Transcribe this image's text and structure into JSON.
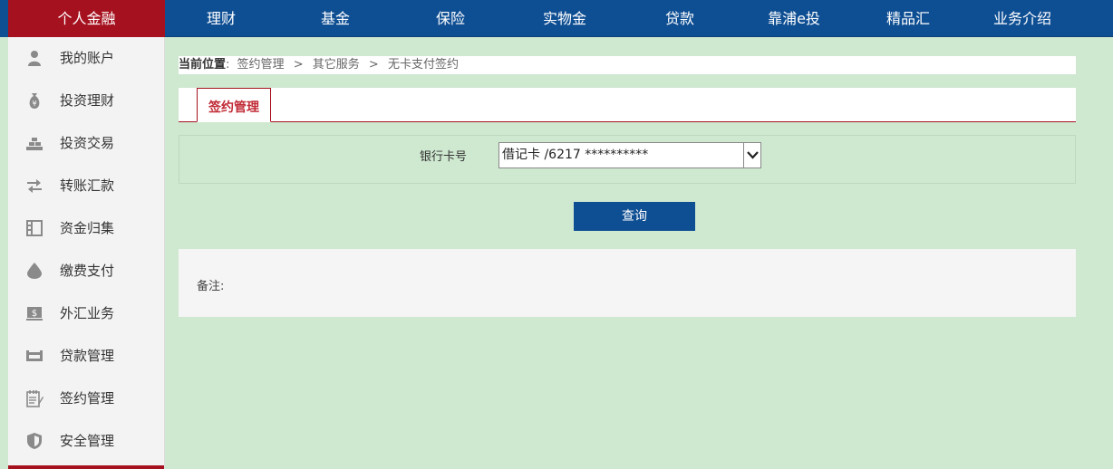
{
  "topnav": {
    "home": "个人金融",
    "items": [
      "理财",
      "基金",
      "保险",
      "实物金",
      "贷款",
      "靠浦e投",
      "精品汇",
      "业务介绍"
    ]
  },
  "sidebar": {
    "items": [
      {
        "label": "我的账户",
        "icon": "user-icon"
      },
      {
        "label": "投资理财",
        "icon": "money-bag-icon"
      },
      {
        "label": "投资交易",
        "icon": "gold-bars-icon"
      },
      {
        "label": "转账汇款",
        "icon": "transfer-arrows-icon"
      },
      {
        "label": "资金归集",
        "icon": "ledger-icon"
      },
      {
        "label": "缴费支付",
        "icon": "water-drop-icon"
      },
      {
        "label": "外汇业务",
        "icon": "currency-screen-icon"
      },
      {
        "label": "贷款管理",
        "icon": "tray-icon"
      },
      {
        "label": "签约管理",
        "icon": "notepad-icon"
      },
      {
        "label": "安全管理",
        "icon": "shield-icon"
      }
    ]
  },
  "breadcrumb": {
    "label": "当前位置",
    "colon": ":",
    "parts": [
      "签约管理",
      "其它服务",
      "无卡支付签约"
    ],
    "separator": ">"
  },
  "tabs": {
    "active": "签约管理"
  },
  "form": {
    "card_label": "银行卡号",
    "card_value": "借记卡 /6217 **********"
  },
  "actions": {
    "query_label": "查询"
  },
  "notes": {
    "label": "备注:"
  },
  "colors": {
    "nav_blue": "#0e4e93",
    "brand_red": "#a6111f",
    "background_green": "#cfe8d0"
  }
}
